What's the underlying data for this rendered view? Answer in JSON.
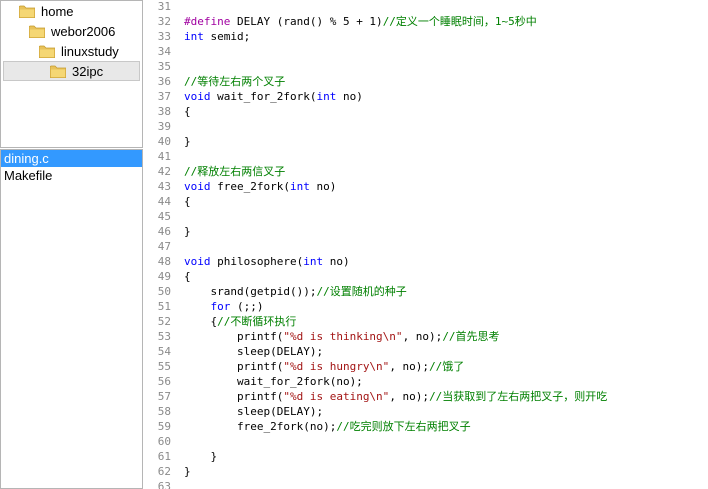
{
  "folder_tree": [
    {
      "label": "home",
      "indent": 0,
      "selected": false
    },
    {
      "label": "webor2006",
      "indent": 1,
      "selected": false
    },
    {
      "label": "linuxstudy",
      "indent": 2,
      "selected": false
    },
    {
      "label": "32ipc",
      "indent": 3,
      "selected": true
    }
  ],
  "files": [
    {
      "label": "dining.c",
      "selected": true
    },
    {
      "label": "Makefile",
      "selected": false
    }
  ],
  "colors": {
    "selection": "#3399ff",
    "keyword": "#0000ff",
    "comment": "#008000",
    "string": "#a31515",
    "preprocessor": "#a000a0"
  },
  "code_lines": [
    {
      "n": "31",
      "segs": []
    },
    {
      "n": "32",
      "segs": [
        {
          "t": "pp",
          "v": "#define"
        },
        {
          "t": "tx",
          "v": " DELAY (rand() % 5 + 1)"
        },
        {
          "t": "cm",
          "v": "//定义一个睡眠时间，1~5秒中"
        }
      ]
    },
    {
      "n": "33",
      "segs": [
        {
          "t": "kw",
          "v": "int"
        },
        {
          "t": "tx",
          "v": " semid;"
        }
      ]
    },
    {
      "n": "34",
      "segs": []
    },
    {
      "n": "35",
      "segs": []
    },
    {
      "n": "36",
      "segs": [
        {
          "t": "cm",
          "v": "//等待左右两个叉子"
        }
      ]
    },
    {
      "n": "37",
      "segs": [
        {
          "t": "kw",
          "v": "void"
        },
        {
          "t": "tx",
          "v": " wait_for_2fork("
        },
        {
          "t": "kw",
          "v": "int"
        },
        {
          "t": "tx",
          "v": " no)"
        }
      ]
    },
    {
      "n": "38",
      "segs": [
        {
          "t": "tx",
          "v": "{"
        }
      ]
    },
    {
      "n": "39",
      "segs": []
    },
    {
      "n": "40",
      "segs": [
        {
          "t": "tx",
          "v": "}"
        }
      ]
    },
    {
      "n": "41",
      "segs": []
    },
    {
      "n": "42",
      "segs": [
        {
          "t": "cm",
          "v": "//释放左右两信叉子"
        }
      ]
    },
    {
      "n": "43",
      "segs": [
        {
          "t": "kw",
          "v": "void"
        },
        {
          "t": "tx",
          "v": " free_2fork("
        },
        {
          "t": "kw",
          "v": "int"
        },
        {
          "t": "tx",
          "v": " no)"
        }
      ]
    },
    {
      "n": "44",
      "segs": [
        {
          "t": "tx",
          "v": "{"
        }
      ]
    },
    {
      "n": "45",
      "segs": []
    },
    {
      "n": "46",
      "segs": [
        {
          "t": "tx",
          "v": "}"
        }
      ]
    },
    {
      "n": "47",
      "segs": []
    },
    {
      "n": "48",
      "segs": [
        {
          "t": "kw",
          "v": "void"
        },
        {
          "t": "tx",
          "v": " philosophere("
        },
        {
          "t": "kw",
          "v": "int"
        },
        {
          "t": "tx",
          "v": " no)"
        }
      ]
    },
    {
      "n": "49",
      "segs": [
        {
          "t": "tx",
          "v": "{"
        }
      ]
    },
    {
      "n": "50",
      "segs": [
        {
          "t": "tx",
          "v": "    srand(getpid());"
        },
        {
          "t": "cm",
          "v": "//设置随机的种子"
        }
      ]
    },
    {
      "n": "51",
      "segs": [
        {
          "t": "tx",
          "v": "    "
        },
        {
          "t": "kw",
          "v": "for"
        },
        {
          "t": "tx",
          "v": " (;;)"
        }
      ]
    },
    {
      "n": "52",
      "segs": [
        {
          "t": "tx",
          "v": "    {"
        },
        {
          "t": "cm",
          "v": "//不断循环执行"
        }
      ]
    },
    {
      "n": "53",
      "segs": [
        {
          "t": "tx",
          "v": "        printf("
        },
        {
          "t": "st",
          "v": "\"%d is thinking\\n\""
        },
        {
          "t": "tx",
          "v": ", no);"
        },
        {
          "t": "cm",
          "v": "//首先思考"
        }
      ]
    },
    {
      "n": "54",
      "segs": [
        {
          "t": "tx",
          "v": "        sleep(DELAY);"
        }
      ]
    },
    {
      "n": "55",
      "segs": [
        {
          "t": "tx",
          "v": "        printf("
        },
        {
          "t": "st",
          "v": "\"%d is hungry\\n\""
        },
        {
          "t": "tx",
          "v": ", no);"
        },
        {
          "t": "cm",
          "v": "//饿了"
        }
      ]
    },
    {
      "n": "56",
      "segs": [
        {
          "t": "tx",
          "v": "        wait_for_2fork(no);"
        }
      ]
    },
    {
      "n": "57",
      "segs": [
        {
          "t": "tx",
          "v": "        printf("
        },
        {
          "t": "st",
          "v": "\"%d is eating\\n\""
        },
        {
          "t": "tx",
          "v": ", no);"
        },
        {
          "t": "cm",
          "v": "//当获取到了左右两把叉子，则开吃"
        }
      ]
    },
    {
      "n": "58",
      "segs": [
        {
          "t": "tx",
          "v": "        sleep(DELAY);"
        }
      ]
    },
    {
      "n": "59",
      "segs": [
        {
          "t": "tx",
          "v": "        free_2fork(no);"
        },
        {
          "t": "cm",
          "v": "//吃完则放下左右两把叉子"
        }
      ]
    },
    {
      "n": "60",
      "segs": []
    },
    {
      "n": "61",
      "segs": [
        {
          "t": "tx",
          "v": "    }"
        }
      ]
    },
    {
      "n": "62",
      "segs": [
        {
          "t": "tx",
          "v": "}"
        }
      ]
    },
    {
      "n": "63",
      "segs": []
    }
  ]
}
